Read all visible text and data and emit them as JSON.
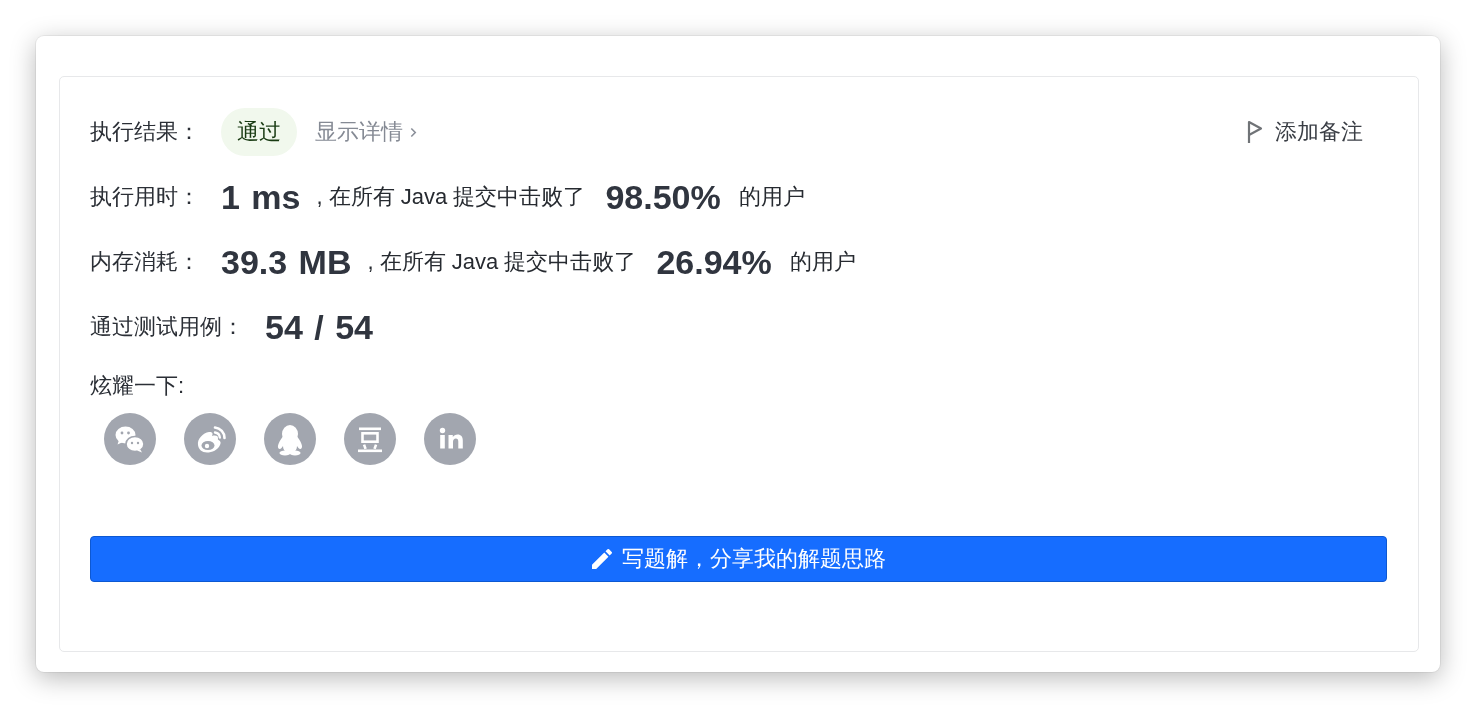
{
  "header": {
    "label": "执行结果：",
    "status": {
      "text": "通过",
      "kind": "success"
    },
    "details_link": "显示详情",
    "add_note": "添加备注"
  },
  "stats": [
    {
      "label": "执行用时：",
      "value": "1 ms",
      "comparison": ", 在所有 Java 提交中击败了",
      "percent": "98.50%",
      "suffix": "的用户"
    },
    {
      "label": "内存消耗：",
      "value": "39.3 MB",
      "comparison": ", 在所有 Java 提交中击败了",
      "percent": "26.94%",
      "suffix": "的用户"
    },
    {
      "label": "通过测试用例：",
      "value": "54 / 54"
    }
  ],
  "share": {
    "label": "炫耀一下:",
    "buttons": [
      {
        "kind": "chat"
      },
      {
        "kind": "eye"
      },
      {
        "kind": "penguin"
      },
      {
        "kind": "bean"
      },
      {
        "kind": "letters"
      }
    ]
  },
  "write_button": "写题解，分享我的解题思路"
}
